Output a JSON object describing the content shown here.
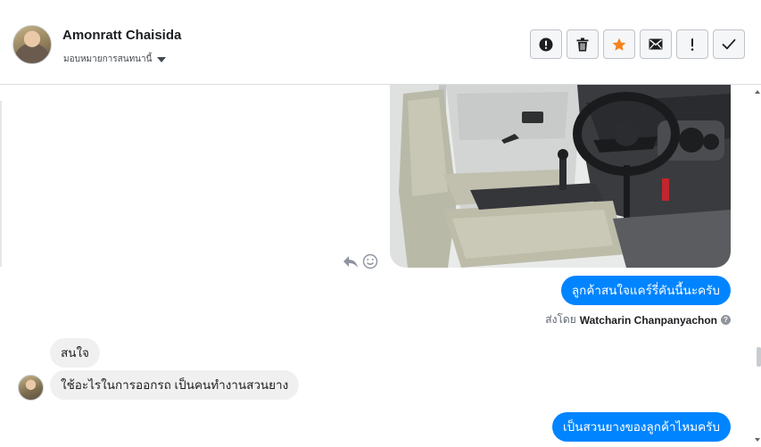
{
  "contact": {
    "name": "Amonratt Chaisida",
    "assign_label": "มอบหมายการสนทนานี้"
  },
  "actions": [
    {
      "name": "spam-button",
      "icon": "exclamation-circle-icon"
    },
    {
      "name": "delete-button",
      "icon": "trash-icon"
    },
    {
      "name": "star-button",
      "icon": "star-icon",
      "color": "#f5821f"
    },
    {
      "name": "mark-unread-button",
      "icon": "envelope-icon"
    },
    {
      "name": "follow-up-button",
      "icon": "exclamation-icon"
    },
    {
      "name": "mark-done-button",
      "icon": "checkmark-icon"
    }
  ],
  "messages": {
    "outgoing_1": "ลูกค้าสนใจแคร์รี่คันนี้นะครับ",
    "sent_by_prefix": "ส่งโดย",
    "sent_by_name": "Watcharin Chanpanyachon",
    "incoming_1": "สนใจ",
    "incoming_2": "ใช้อะไรในการออกรถ เป็นคนทำงานสวนยาง",
    "outgoing_2": "เป็นสวนยางของลูกค้าไหมครับ"
  },
  "colors": {
    "outgoing_bubble": "#0084ff",
    "incoming_bubble": "#f0f0f0"
  }
}
